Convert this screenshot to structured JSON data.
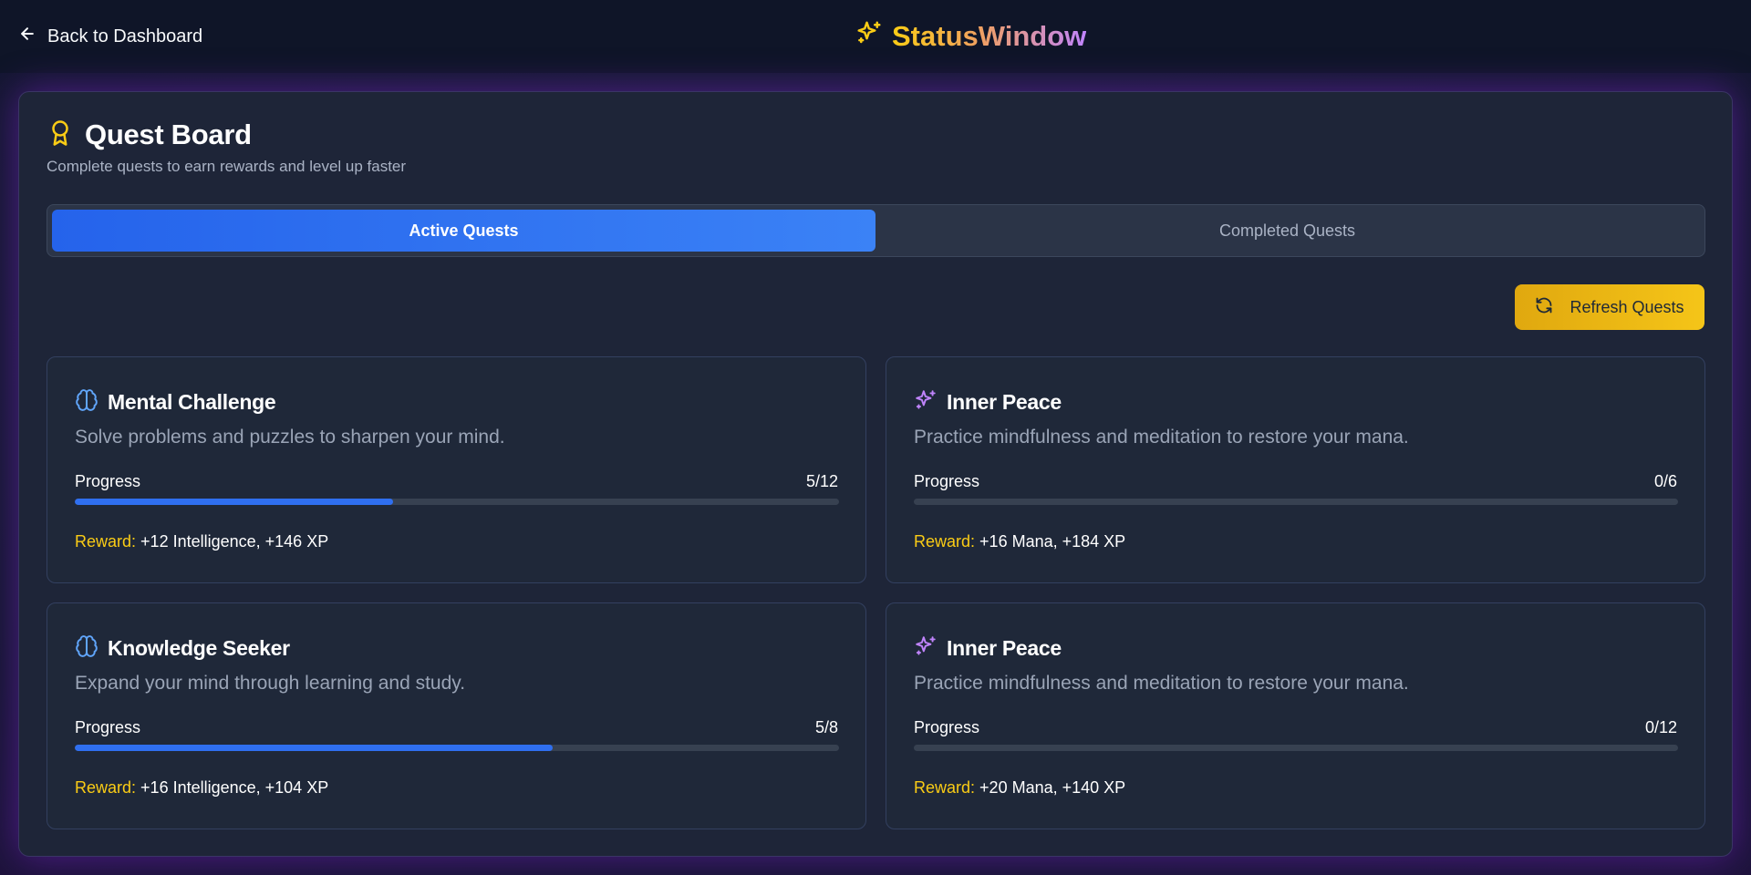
{
  "header": {
    "back_label": "Back to Dashboard",
    "brand": "StatusWindow"
  },
  "board": {
    "title": "Quest Board",
    "subtitle": "Complete quests to earn rewards and level up faster",
    "tabs": [
      {
        "label": "Active Quests",
        "active": true
      },
      {
        "label": "Completed Quests",
        "active": false
      }
    ],
    "refresh_label": "Refresh Quests"
  },
  "quests": [
    {
      "title": "Mental Challenge",
      "icon": "brain-icon",
      "description": "Solve problems and puzzles to sharpen your mind.",
      "progress_label": "Progress",
      "progress_text": "5/12",
      "progress": 0.4167,
      "reward_label": "Reward:",
      "reward": "+12 Intelligence, +146 XP"
    },
    {
      "title": "Inner Peace",
      "icon": "sparkles-icon",
      "description": "Practice mindfulness and meditation to restore your mana.",
      "progress_label": "Progress",
      "progress_text": "0/6",
      "progress": 0,
      "reward_label": "Reward:",
      "reward": "+16 Mana, +184 XP"
    },
    {
      "title": "Knowledge Seeker",
      "icon": "brain-icon",
      "description": "Expand your mind through learning and study.",
      "progress_label": "Progress",
      "progress_text": "5/8",
      "progress": 0.625,
      "reward_label": "Reward:",
      "reward": "+16 Intelligence, +104 XP"
    },
    {
      "title": "Inner Peace",
      "icon": "sparkles-icon",
      "description": "Practice mindfulness and meditation to restore your mana.",
      "progress_label": "Progress",
      "progress_text": "0/12",
      "progress": 0,
      "reward_label": "Reward:",
      "reward": "+20 Mana, +140 XP"
    }
  ],
  "colors": {
    "accent_blue": "#3b82f6",
    "accent_gold": "#facc15",
    "accent_purple": "#c084fc",
    "panel_bg": "#1e2538"
  }
}
